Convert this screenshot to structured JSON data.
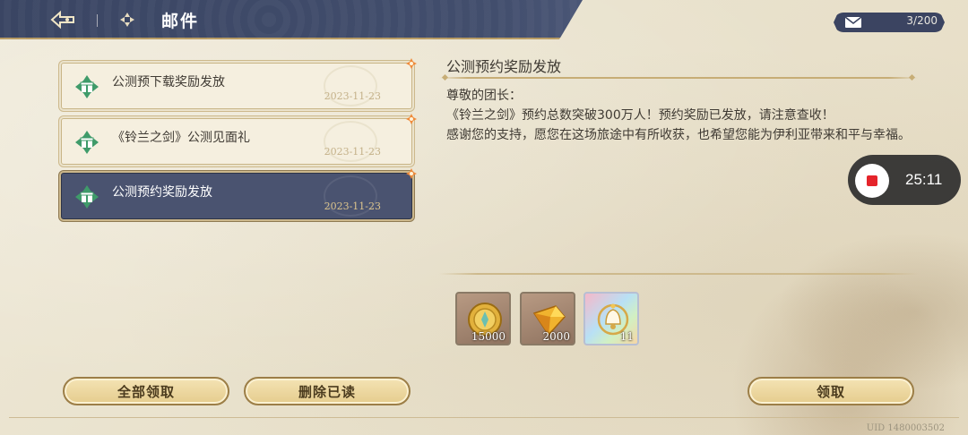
{
  "header": {
    "title": "邮件",
    "back_icon": "back-arrow-icon",
    "mail_icon": "mail-clover-icon"
  },
  "mail_count": {
    "text": "3/200",
    "icon": "envelope-icon"
  },
  "mail_list": [
    {
      "title": "公测预下载奖励发放",
      "date": "2023-11-23",
      "selected": false
    },
    {
      "title": "《铃兰之剑》公测见面礼",
      "date": "2023-11-23",
      "selected": false
    },
    {
      "title": "公测预约奖励发放",
      "date": "2023-11-23",
      "selected": true
    }
  ],
  "detail": {
    "title": "公测预约奖励发放",
    "greeting": "尊敬的团长：",
    "line1": "《铃兰之剑》预约总数突破300万人！预约奖励已发放，请注意查收！",
    "line2": "感谢您的支持，愿您在这场旅途中有所收获，也希望您能为伊利亚带来和平与幸福。"
  },
  "rewards": [
    {
      "name": "gold-coin",
      "qty": "15000"
    },
    {
      "name": "gold-crystal",
      "qty": "2000"
    },
    {
      "name": "bell-charm",
      "qty": "11"
    }
  ],
  "buttons": {
    "claim_all": "全部领取",
    "delete_read": "删除已读",
    "claim": "领取"
  },
  "recorder": {
    "time": "25:11"
  },
  "uid": "UID 1480003502",
  "colors": {
    "header_bg": "#3a4563",
    "selected_item_bg": "#4a5370",
    "button_gold": "#e5cc8d",
    "unread_badge": "#f08a3a"
  }
}
